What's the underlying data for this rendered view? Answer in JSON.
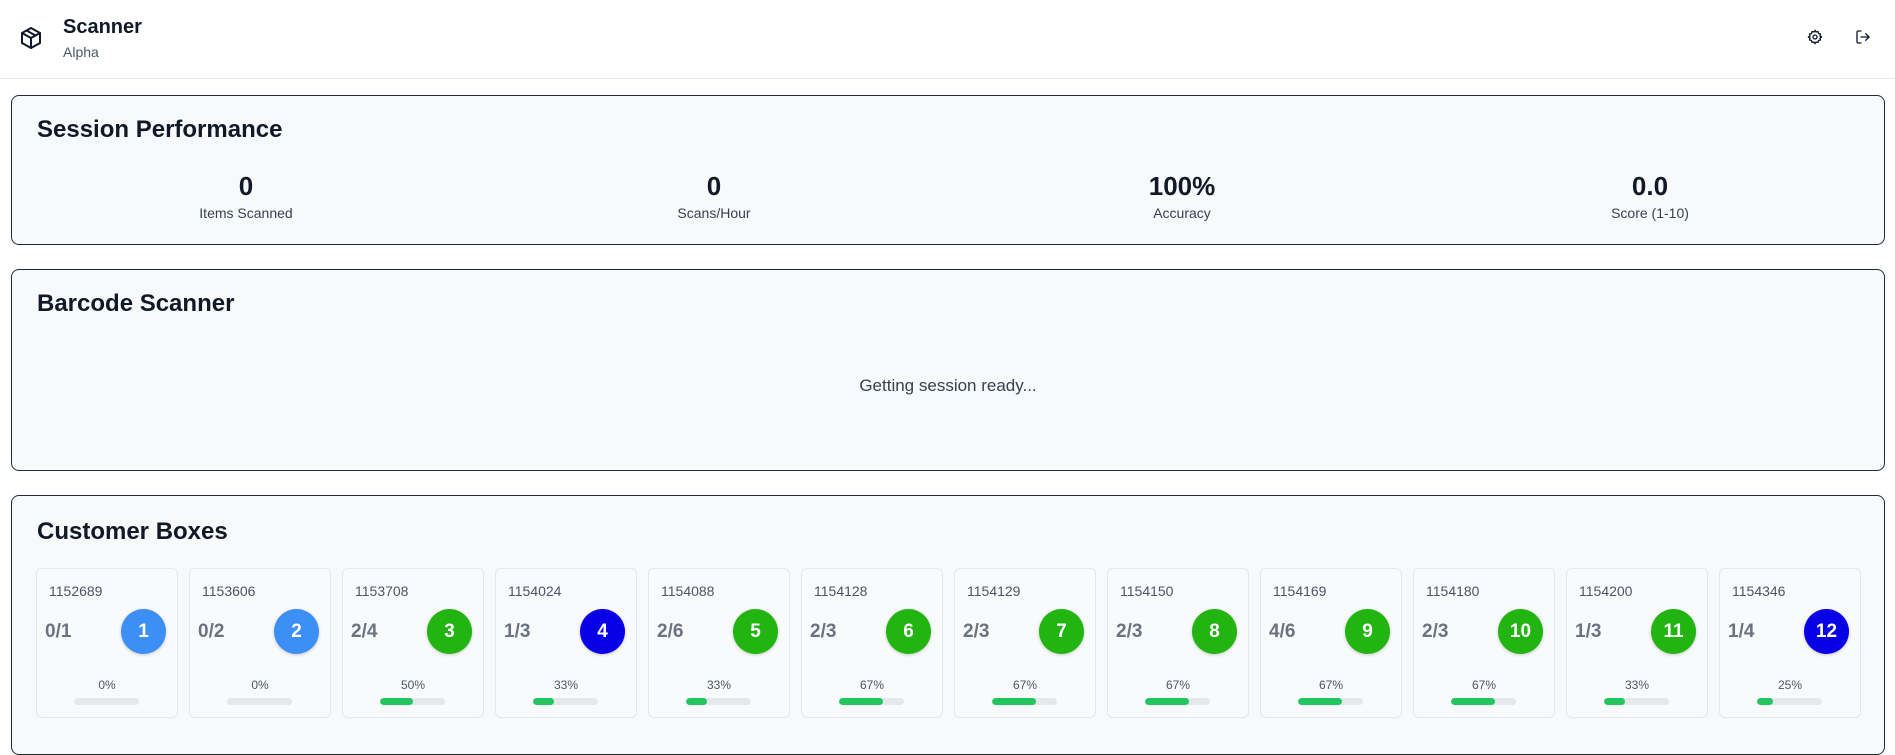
{
  "header": {
    "title": "Scanner",
    "subtitle": "Alpha",
    "logo_icon": "package-box-icon",
    "actions": [
      {
        "icon": "gear-icon",
        "label": "Settings"
      },
      {
        "icon": "logout-icon",
        "label": "Log out"
      }
    ]
  },
  "performance": {
    "title": "Session Performance",
    "stats": [
      {
        "value": "0",
        "label": "Items Scanned"
      },
      {
        "value": "0",
        "label": "Scans/Hour"
      },
      {
        "value": "100%",
        "label": "Accuracy"
      },
      {
        "value": "0.0",
        "label": "Score (1-10)"
      }
    ]
  },
  "scanner": {
    "title": "Barcode Scanner",
    "status": "Getting session ready..."
  },
  "boxes": {
    "title": "Customer Boxes",
    "colors": {
      "blue_light": "#3b8ff5",
      "green": "#22b411",
      "blue_dark": "#0a00e6",
      "progress": "#22c55e"
    },
    "items": [
      {
        "id": "1152689",
        "count": "0/1",
        "number": "1",
        "color": "#3b8ff5",
        "percent_label": "0%",
        "progress": 0
      },
      {
        "id": "1153606",
        "count": "0/2",
        "number": "2",
        "color": "#3b8ff5",
        "percent_label": "0%",
        "progress": 0
      },
      {
        "id": "1153708",
        "count": "2/4",
        "number": "3",
        "color": "#22b411",
        "percent_label": "50%",
        "progress": 50
      },
      {
        "id": "1154024",
        "count": "1/3",
        "number": "4",
        "color": "#0a00e6",
        "percent_label": "33%",
        "progress": 33
      },
      {
        "id": "1154088",
        "count": "2/6",
        "number": "5",
        "color": "#22b411",
        "percent_label": "33%",
        "progress": 33
      },
      {
        "id": "1154128",
        "count": "2/3",
        "number": "6",
        "color": "#22b411",
        "percent_label": "67%",
        "progress": 67
      },
      {
        "id": "1154129",
        "count": "2/3",
        "number": "7",
        "color": "#22b411",
        "percent_label": "67%",
        "progress": 67
      },
      {
        "id": "1154150",
        "count": "2/3",
        "number": "8",
        "color": "#22b411",
        "percent_label": "67%",
        "progress": 67
      },
      {
        "id": "1154169",
        "count": "4/6",
        "number": "9",
        "color": "#22b411",
        "percent_label": "67%",
        "progress": 67
      },
      {
        "id": "1154180",
        "count": "2/3",
        "number": "10",
        "color": "#22b411",
        "percent_label": "67%",
        "progress": 67
      },
      {
        "id": "1154200",
        "count": "1/3",
        "number": "11",
        "color": "#22b411",
        "percent_label": "33%",
        "progress": 33
      },
      {
        "id": "1154346",
        "count": "1/4",
        "number": "12",
        "color": "#0a00e6",
        "percent_label": "25%",
        "progress": 25
      }
    ]
  }
}
